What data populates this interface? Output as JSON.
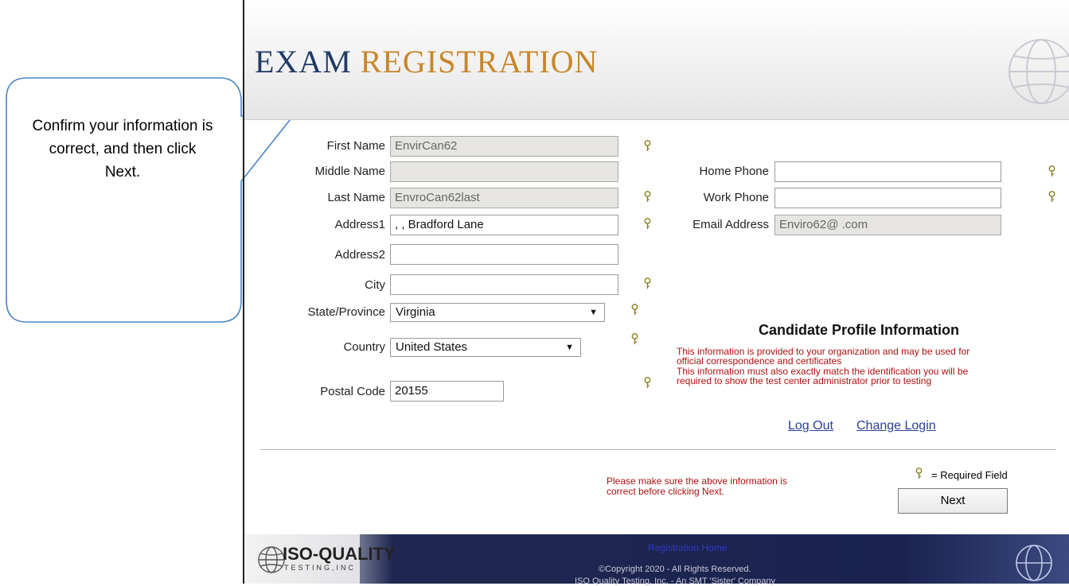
{
  "callout": {
    "text": "Confirm your information is correct, and then click Next."
  },
  "header": {
    "title_part1": "EXAM",
    "title_part2": "REGISTRATION"
  },
  "form": {
    "first_name": {
      "label": "First Name",
      "value": "EnvirCan62"
    },
    "middle_name": {
      "label": "Middle Name",
      "value": ""
    },
    "last_name": {
      "label": "Last Name",
      "value": "EnvroCan62last"
    },
    "address1": {
      "label": "Address1",
      "value": ", , Bradford Lane"
    },
    "address2": {
      "label": "Address2",
      "value": ""
    },
    "city": {
      "label": "City",
      "value": ""
    },
    "state": {
      "label": "State/Province",
      "value": "Virginia"
    },
    "country": {
      "label": "Country",
      "value": "United States"
    },
    "postal_code": {
      "label": "Postal Code",
      "value": "20155"
    },
    "home_phone": {
      "label": "Home Phone",
      "value": ""
    },
    "work_phone": {
      "label": "Work Phone",
      "value": ""
    },
    "email": {
      "label": "Email Address",
      "value": "Enviro62@                 .com"
    }
  },
  "profile": {
    "title": "Candidate Profile Information",
    "line1": "This information is provided to your organization and may be used for",
    "line2": "official correspondence and certificates",
    "line3": "This information must also exactly match the identification you will be",
    "line4": "required to show the test center administrator prior to testing"
  },
  "links": {
    "logout": "Log Out",
    "change_login": "Change Login"
  },
  "notice": {
    "line1": "Please make sure the above information is",
    "line2": "correct before clicking Next."
  },
  "legend": {
    "required": "= Required Field"
  },
  "buttons": {
    "next": "Next"
  },
  "footer": {
    "registration_home": "Registration Home",
    "copyright": "©Copyright 2020 - All Rights Reserved.",
    "company_line": "ISO Quality Testing, Inc. - An SMT 'Sister' Company",
    "logo_main": "ISO-QUALITY",
    "logo_sub": "TESTING,INC"
  },
  "colors": {
    "title_blue": "#1f3a66",
    "title_gold": "#c8862a",
    "warning_red": "#b01010",
    "link_blue": "#2a3f9a",
    "callout_stroke": "#4a86c5"
  }
}
